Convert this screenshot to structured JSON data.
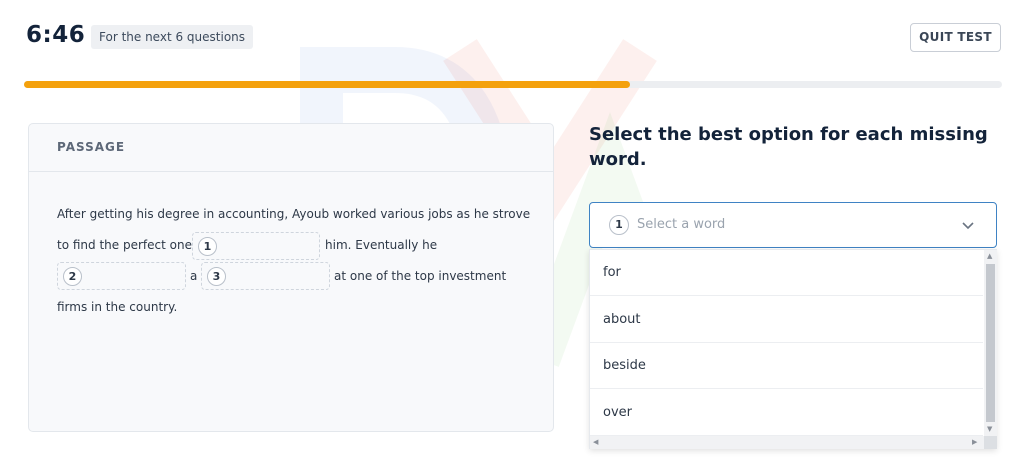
{
  "header": {
    "timer": "6:46",
    "badge": "For the next 6 questions",
    "quit_label": "QUIT TEST"
  },
  "progress": {
    "value_percent": 62
  },
  "passage": {
    "title": "PASSAGE",
    "line1": "After getting his degree in accounting, Ayoub worked various jobs as he strove",
    "line2a": "to find the perfect one",
    "gap1": "1",
    "line2b": "him. Eventually he",
    "gap2": "2",
    "line3a": "a",
    "gap3": "3",
    "line3b": "at one of the top investment",
    "line4": "firms in the country."
  },
  "question": {
    "prompt": "Select the best option for each missing word."
  },
  "select": {
    "number": "1",
    "placeholder": "Select a word",
    "options": [
      "for",
      "about",
      "beside",
      "over"
    ]
  },
  "colors": {
    "accent": "#f4a10d",
    "select_border": "#3f83c4",
    "watermark_blue": "#3a6fd8",
    "watermark_red": "#e8412c",
    "watermark_green": "#57b84a"
  }
}
